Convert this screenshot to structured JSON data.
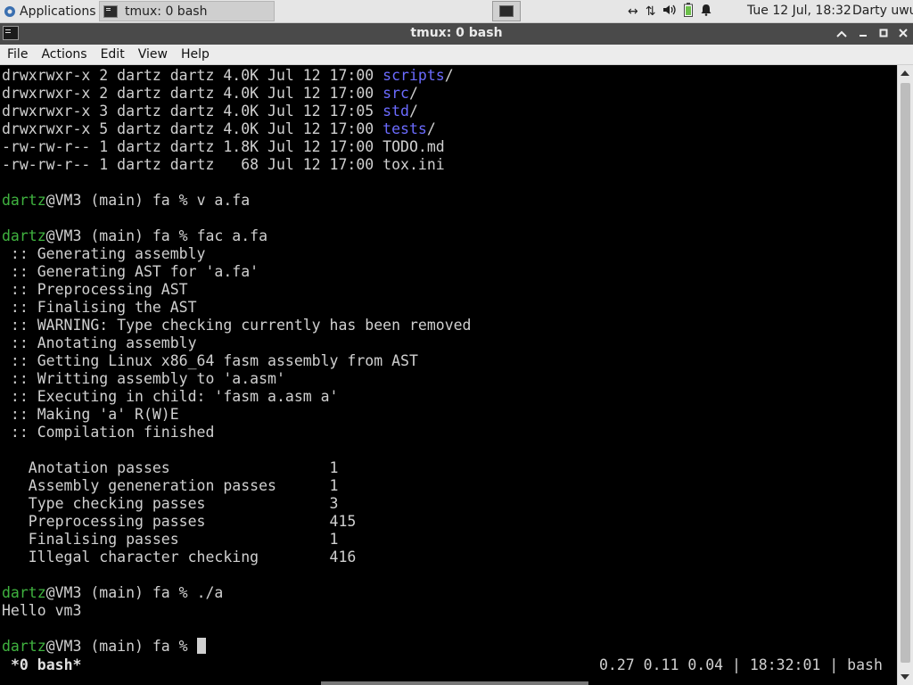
{
  "panel": {
    "applications_label": "Applications",
    "task_label": "tmux: 0 bash",
    "clock": "Tue 12 Jul, 18:32",
    "user": "Darty uwu",
    "tray_icons": [
      "network-arrows-icon",
      "transfer-icon",
      "volume-icon",
      "battery-icon",
      "bell-icon"
    ]
  },
  "window": {
    "title": "tmux: 0 bash",
    "controls": [
      "minimize-up",
      "minimize",
      "maximize",
      "close"
    ]
  },
  "menu": [
    "File",
    "Actions",
    "Edit",
    "View",
    "Help"
  ],
  "terminal": {
    "lines": [
      {
        "prefix": "drwxrwxr-x 2 dartz dartz 4.0K Jul 12 17:00 ",
        "dir": "scripts",
        "suffix": "/"
      },
      {
        "prefix": "drwxrwxr-x 2 dartz dartz 4.0K Jul 12 17:00 ",
        "dir": "src",
        "suffix": "/"
      },
      {
        "prefix": "drwxrwxr-x 3 dartz dartz 4.0K Jul 12 17:05 ",
        "dir": "std",
        "suffix": "/"
      },
      {
        "prefix": "drwxrwxr-x 5 dartz dartz 4.0K Jul 12 17:00 ",
        "dir": "tests",
        "suffix": "/"
      },
      {
        "text": "-rw-rw-r-- 1 dartz dartz 1.8K Jul 12 17:00 TODO.md"
      },
      {
        "text": "-rw-rw-r-- 1 dartz dartz   68 Jul 12 17:00 tox.ini"
      },
      {
        "text": ""
      },
      {
        "user": "dartz",
        "prompt": "@VM3 (main) fa % ",
        "cmd": "v a.fa"
      },
      {
        "text": ""
      },
      {
        "user": "dartz",
        "prompt": "@VM3 (main) fa % ",
        "cmd": "fac a.fa"
      },
      {
        "text": " :: Generating assembly"
      },
      {
        "text": " :: Generating AST for 'a.fa'"
      },
      {
        "text": " :: Preprocessing AST"
      },
      {
        "text": " :: Finalising the AST"
      },
      {
        "text": " :: WARNING: Type checking currently has been removed"
      },
      {
        "text": " :: Anotating assembly"
      },
      {
        "text": " :: Getting Linux x86_64 fasm assembly from AST"
      },
      {
        "text": " :: Writting assembly to 'a.asm'"
      },
      {
        "text": " :: Executing in child: 'fasm a.asm a'"
      },
      {
        "text": " :: Making 'a' R(W)E"
      },
      {
        "text": " :: Compilation finished"
      },
      {
        "text": ""
      },
      {
        "text": "   Anotation passes                  1"
      },
      {
        "text": "   Assembly geneneration passes      1"
      },
      {
        "text": "   Type checking passes              3"
      },
      {
        "text": "   Preprocessing passes              415"
      },
      {
        "text": "   Finalising passes                 1"
      },
      {
        "text": "   Illegal character checking        416"
      },
      {
        "text": ""
      },
      {
        "user": "dartz",
        "prompt": "@VM3 (main) fa % ",
        "cmd": "./a"
      },
      {
        "text": "Hello vm3"
      },
      {
        "text": ""
      },
      {
        "user": "dartz",
        "prompt": "@VM3 (main) fa % ",
        "cmd": "",
        "cursor": true
      }
    ],
    "status_left": "*0 bash*",
    "status_right": "0.27 0.11 0.04 | 18:32:01 | bash"
  }
}
